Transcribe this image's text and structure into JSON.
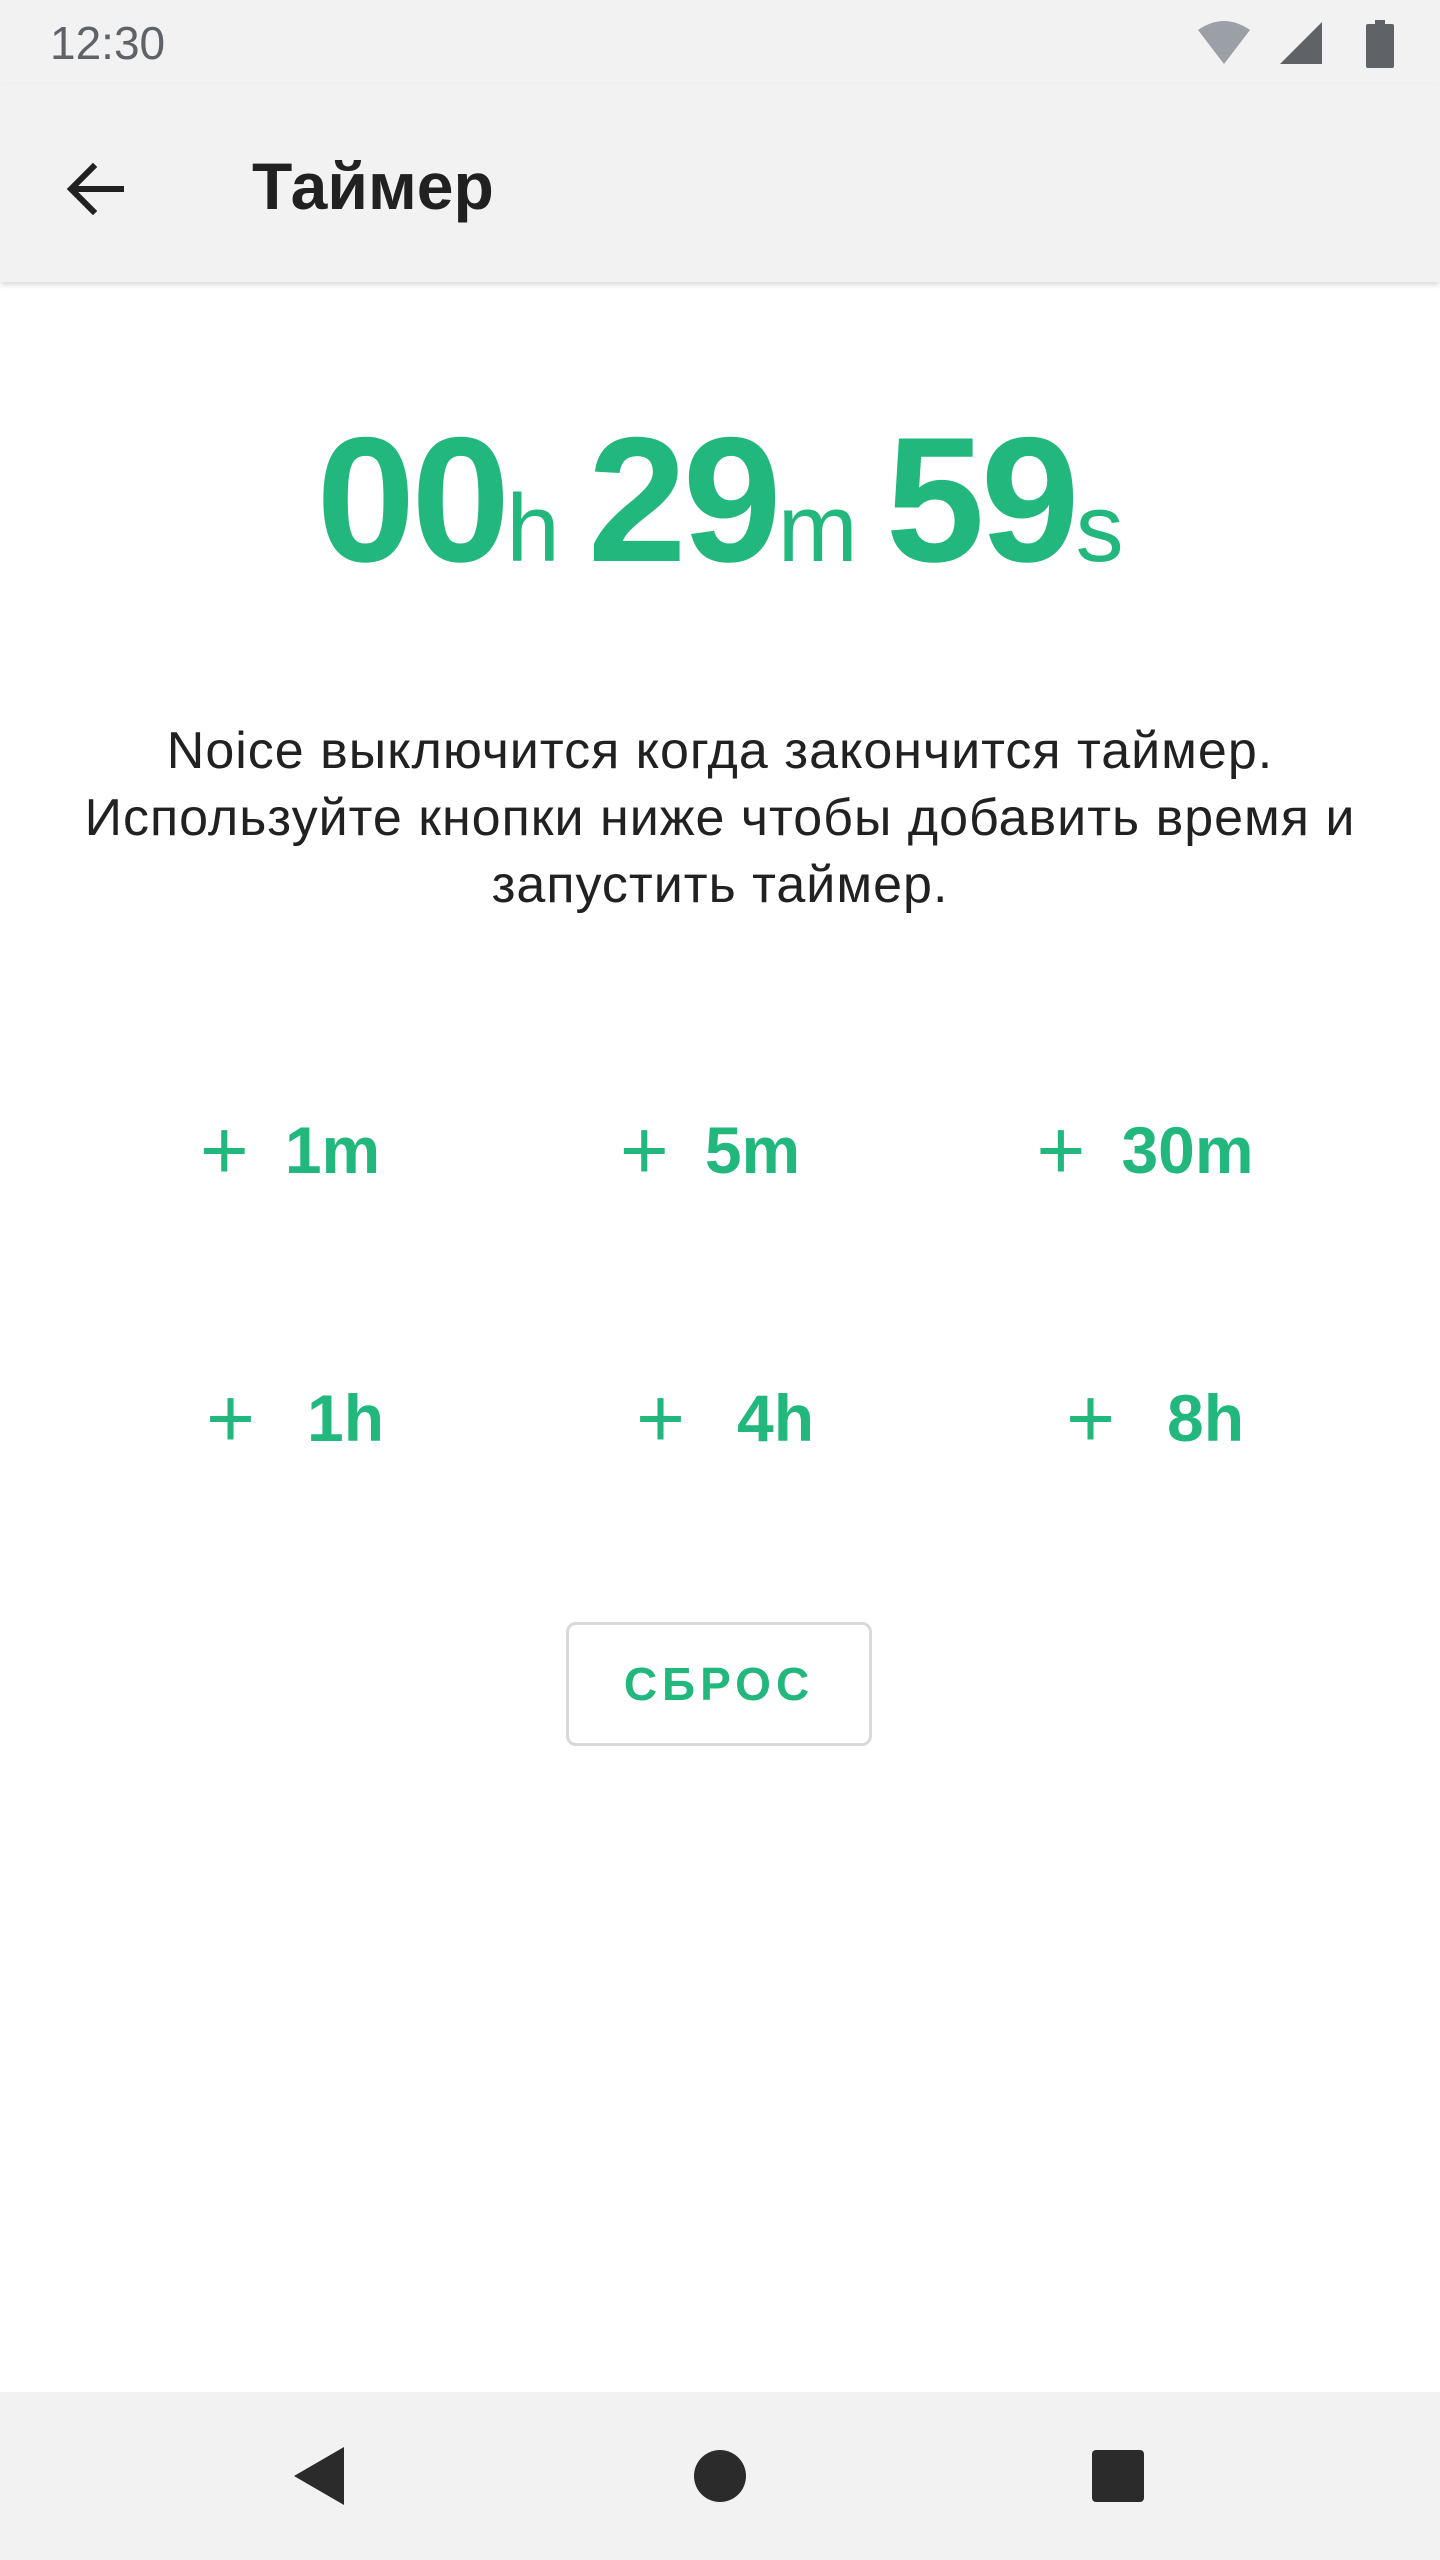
{
  "status_bar": {
    "time": "12:30",
    "icons": [
      "wifi-icon",
      "cellular-signal-icon",
      "battery-icon"
    ]
  },
  "app_bar": {
    "back_icon": "arrow-back-icon",
    "title": "Таймер"
  },
  "timer": {
    "hours": "00",
    "hours_unit": "h",
    "minutes": "29",
    "minutes_unit": "m",
    "seconds": "59",
    "seconds_unit": "s"
  },
  "description": "Noice выключится когда закончится таймер. Используйте кнопки ниже чтобы добавить время и запустить таймер.",
  "add_buttons": [
    {
      "plus": "+",
      "label": "1m"
    },
    {
      "plus": "+",
      "label": "5m"
    },
    {
      "plus": "+",
      "label": "30m"
    },
    {
      "plus": "+",
      "label": "1h"
    },
    {
      "plus": "+",
      "label": "4h"
    },
    {
      "plus": "+",
      "label": "8h"
    }
  ],
  "reset_button": {
    "label": "СБРОС"
  },
  "nav_bar": {
    "icons": [
      "back-triangle-icon",
      "home-circle-icon",
      "recents-square-icon"
    ]
  },
  "colors": {
    "accent": "#22b77d",
    "bar_background": "#f2f2f2",
    "text_primary": "#212121",
    "status_icons": "#5f6368"
  }
}
